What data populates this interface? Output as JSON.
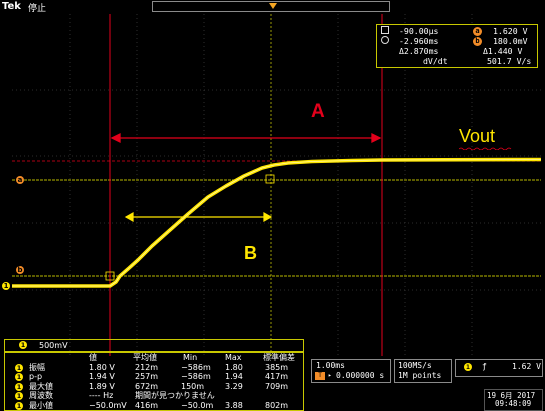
{
  "topbar": {
    "brand": "Tek",
    "status": "停止"
  },
  "cursor_readout": {
    "row1": {
      "a_time": "-90.00µs",
      "b_label": "b",
      "b_value": "1.620 V"
    },
    "row2": {
      "a_time": "-2.960ms",
      "b_label": "b",
      "b_value": "180.0mV"
    },
    "row3": {
      "delta_t": "Δ2.870ms",
      "delta_v": "Δ1.440 V"
    },
    "row4": {
      "label": "dV/dt",
      "value": "501.7 V/s"
    }
  },
  "annotations": {
    "a": "A",
    "b": "B",
    "vout": "Vout"
  },
  "markers": {
    "cursor_a": "a",
    "cursor_b": "b",
    "channel": "1"
  },
  "channel_scale": {
    "badge": "1",
    "value": "500mV"
  },
  "measurements": {
    "headers": [
      "値",
      "平均値",
      "Min",
      "Max",
      "標準偏差"
    ],
    "rows": [
      {
        "badge": "1",
        "name": "振幅",
        "value": "1.80 V",
        "mean": "212m",
        "min": "−586m",
        "max": "1.80",
        "std": "385m"
      },
      {
        "badge": "1",
        "name": "p-p",
        "value": "1.94 V",
        "mean": "257m",
        "min": "−586m",
        "max": "1.94",
        "std": "417m"
      },
      {
        "badge": "1",
        "name": "最大値",
        "value": "1.89 V",
        "mean": "672m",
        "min": "150m",
        "max": "3.29",
        "std": "709m"
      },
      {
        "badge": "1",
        "name": "周波数",
        "value": "---- Hz",
        "note": "期間が見つかりません"
      },
      {
        "badge": "1",
        "name": "最小値",
        "value": "−50.0mV",
        "mean": "416m",
        "min": "−50.0m",
        "max": "3.88",
        "std": "802m"
      }
    ]
  },
  "timebase": {
    "scale": "1.00ms",
    "position": "0.000000 s"
  },
  "acquisition": {
    "rate": "100MS/s",
    "points": "1M points"
  },
  "trigger": {
    "badge": "1",
    "slope": "ƒ",
    "level": "1.62 V"
  },
  "datetime": {
    "date": "19 6月  2017",
    "time": "09:48:09"
  },
  "colors": {
    "ch1": "#ffe600",
    "cursor": "#e3001b",
    "border": "#c8c800"
  }
}
